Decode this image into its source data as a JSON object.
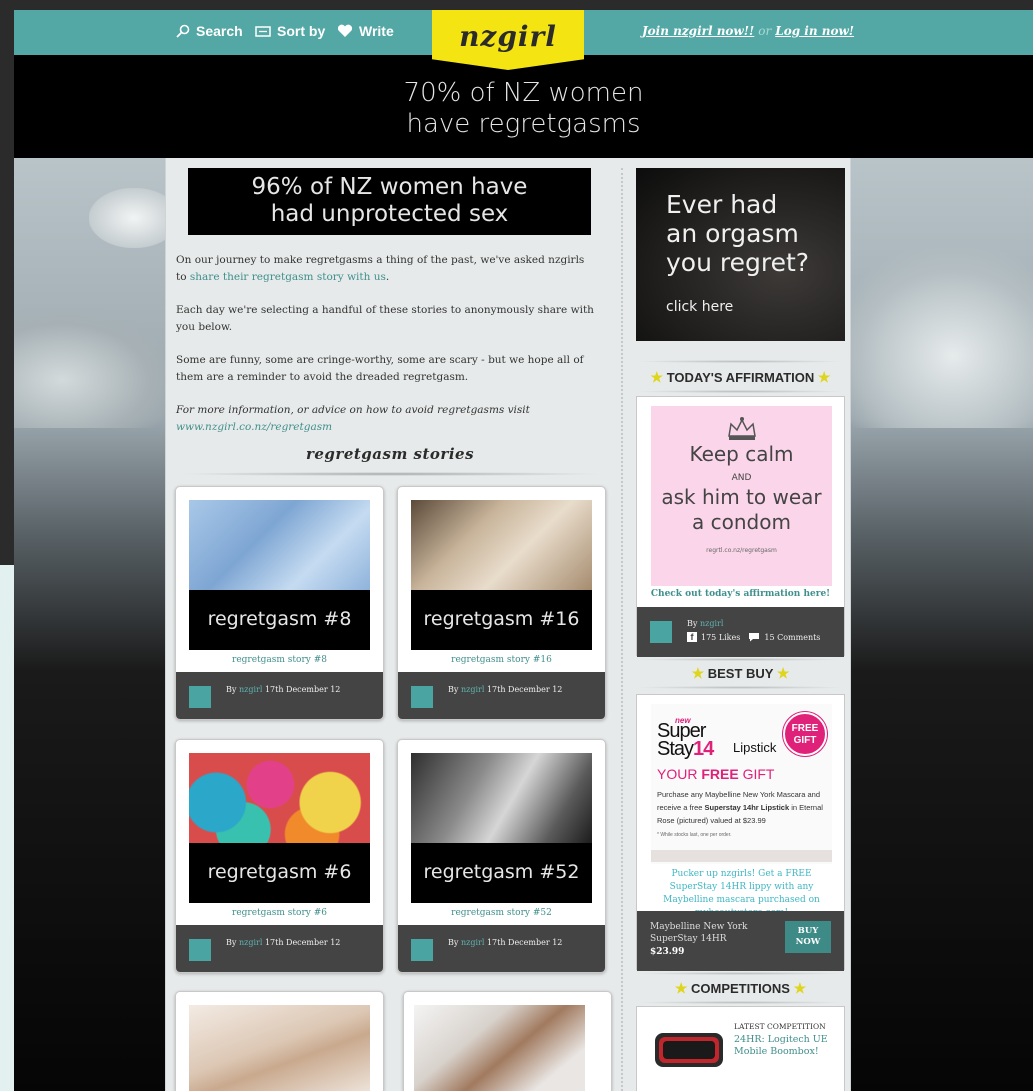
{
  "header": {
    "nav": [
      {
        "label": "Search",
        "icon": "search-icon"
      },
      {
        "label": "Sort by",
        "icon": "sort-icon"
      },
      {
        "label": "Write",
        "icon": "heart-icon"
      }
    ],
    "logo": "nzgirl",
    "join_label": "Join nzgirl now!!",
    "or_label": "or",
    "login_label": "Log in now!"
  },
  "hero": {
    "line1": "70% of NZ women",
    "line2": "have regretgasms"
  },
  "banner": {
    "line1": "96% of NZ women have",
    "line2": "had unprotected sex"
  },
  "intro": {
    "p1_text": "On our journey to make regretgasms a thing of the past, we've asked nzgirls to ",
    "p1_link": "share their regretgasm story with us",
    "p1_end": ".",
    "p2": "Each day we're selecting a handful of these stories to anonymously share with you below.",
    "p3": "Some are funny, some are cringe-worthy, some are scary - but we hope all of them are a reminder to avoid the dreaded regretgasm.",
    "p4": "For more information, or advice on how to avoid regretgasms visit",
    "p4_link": "www.nzgirl.co.nz/regretgasm"
  },
  "stories_title": "regretgasm stories",
  "stories": [
    {
      "caption": "regretgasm #8",
      "link": "regretgasm story #8",
      "by": "By",
      "author": "nzgirl",
      "date": "17th December 12"
    },
    {
      "caption": "regretgasm #16",
      "link": "regretgasm story #16",
      "by": "By",
      "author": "nzgirl",
      "date": "17th December 12"
    },
    {
      "caption": "regretgasm #6",
      "link": "regretgasm story #6",
      "by": "By",
      "author": "nzgirl",
      "date": "17th December 12"
    },
    {
      "caption": "regretgasm #52",
      "link": "regretgasm story #52",
      "by": "By",
      "author": "nzgirl",
      "date": "17th December 12"
    }
  ],
  "sidebar": {
    "promo": {
      "line1": "Ever had",
      "line2": "an orgasm",
      "line3": "you regret?",
      "cta": "click here"
    },
    "affirmation": {
      "heading": "TODAY'S AFFIRMATION",
      "kc1": "Keep calm",
      "kc_and": "AND",
      "kc2": "ask him to wear",
      "kc3": "a condom",
      "kc_url": "regrtl.co.nz/regretgasm",
      "link": "Check out today's affirmation here!",
      "by": "By",
      "author": "nzgirl",
      "likes": "175 Likes",
      "comments": "15 Comments"
    },
    "best_buy": {
      "heading": "BEST BUY",
      "ad_new": "new",
      "ad_brand1": "Super",
      "ad_brand2": "Stay",
      "ad_brand3": "14",
      "ad_lipstick": "Lipstick",
      "ad_free": "FREE GIFT",
      "ad_your": "YOUR",
      "ad_free2": "FREE",
      "ad_gift": "GIFT",
      "ad_copy1": "Purchase any Maybelline New York Mascara and receive a free ",
      "ad_copy_bold": "Superstay 14hr Lipstick",
      "ad_copy2": " in Eternal Rose (pictured) valued at $23.99",
      "ad_note": "* While stocks last, one per order.",
      "description": "Pucker up nzgirls! Get a FREE SuperStay 14HR lippy with any Maybelline mascara purchased on mybeautystore.com!",
      "product": "Maybelline New York SuperStay 14HR",
      "price": "$23.99",
      "buy_label": "BUY NOW"
    },
    "competitions": {
      "heading": "COMPETITIONS",
      "latest_label": "LATEST COMPETITION",
      "title": "24HR: Logitech UE Mobile Boombox!"
    }
  },
  "colors": {
    "teal": "#53a8a5",
    "yellow": "#f4e411",
    "pink": "#e0217a",
    "link": "#3f8f8c"
  }
}
